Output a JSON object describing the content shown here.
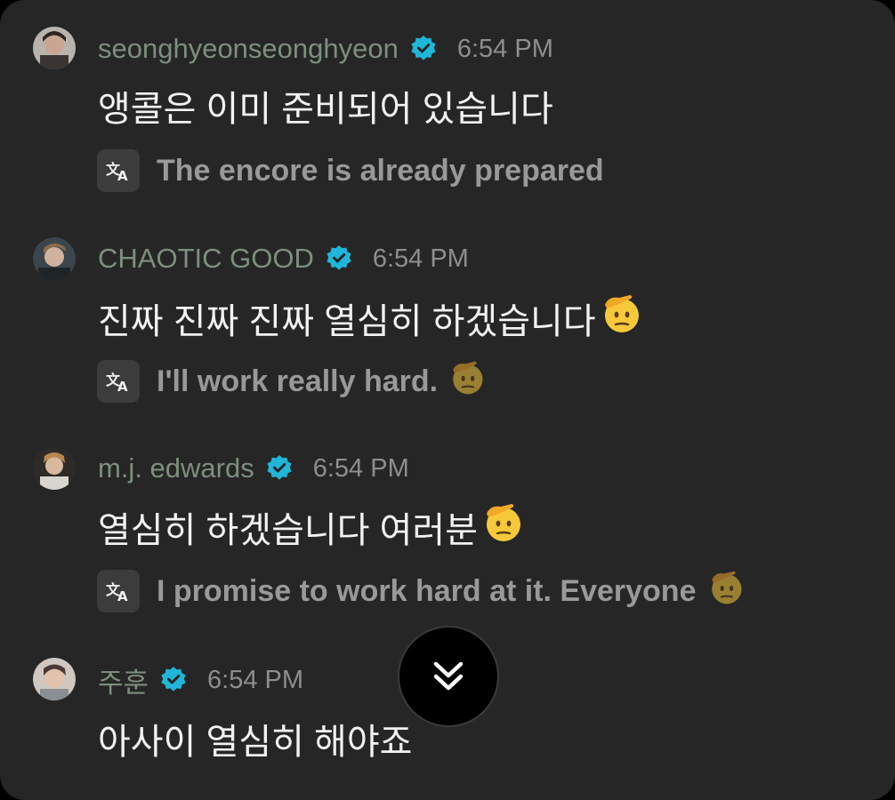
{
  "messages": [
    {
      "username": "seonghyeonseonghyeon",
      "time": "6:54 PM",
      "text": "앵콜은 이미 준비되어 있습니다",
      "translation": "The encore is already prepared",
      "avatar_color": "#8a7a70"
    },
    {
      "username": "CHAOTIC GOOD",
      "time": "6:54 PM",
      "text": "진짜 진짜 진짜 열심히 하겠습니다",
      "translation": "I'll work really hard.",
      "avatar_color": "#5d6670"
    },
    {
      "username": "m.j. edwards",
      "time": "6:54 PM",
      "text": "열심히 하겠습니다 여러분",
      "translation": "I promise to work hard at it. Everyone",
      "avatar_color": "#6a5d55"
    },
    {
      "username": "주훈",
      "time": "6:54 PM",
      "text": "아사이 열심히 해야죠",
      "avatar_color": "#b9b0a8"
    }
  ],
  "icons": {
    "verified": "verified-badge-icon",
    "translate": "translate-icon",
    "emoji": "saluting-face-emoji",
    "scroll": "double-chevron-down-icon"
  },
  "colors": {
    "background": "#262626",
    "username": "#7d8f7d",
    "verified": "#1fb6d9",
    "message_text": "#f2f2f2",
    "translation_text": "#999999",
    "timestamp": "#8e8e8e"
  }
}
